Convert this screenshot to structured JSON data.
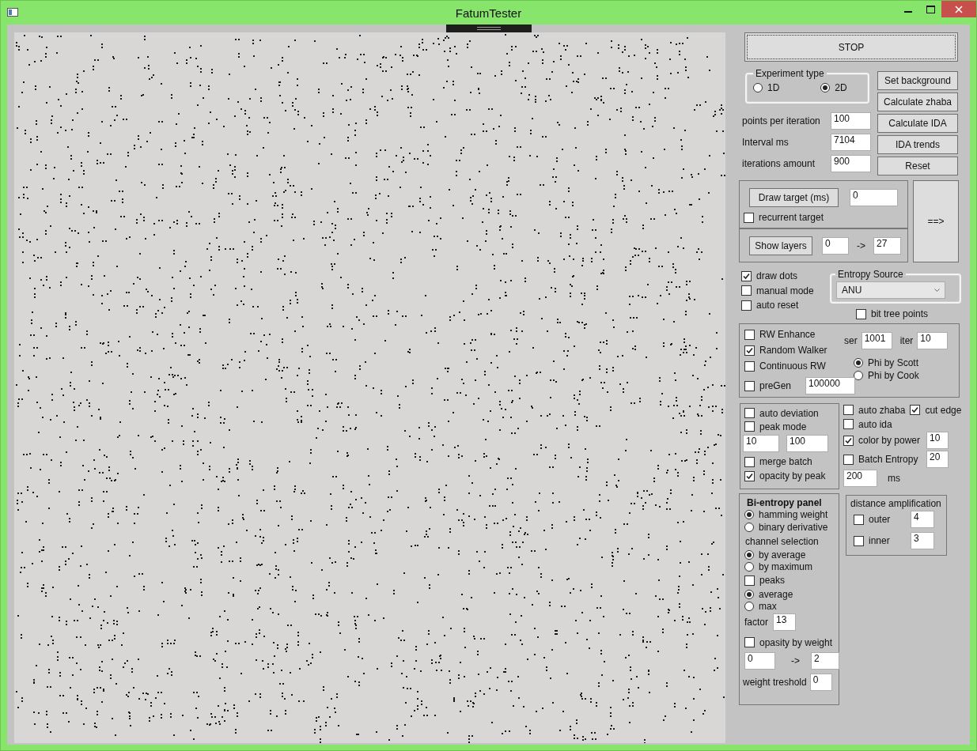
{
  "window": {
    "title": "FatumTester"
  },
  "stop_button": "STOP",
  "experiment_type": {
    "title": "Experiment type",
    "options": [
      {
        "label": "1D",
        "selected": false
      },
      {
        "label": "2D",
        "selected": true
      }
    ]
  },
  "action_buttons": [
    "Set background",
    "Calculate zhaba",
    "Calculate IDA",
    "IDA trends",
    "Reset"
  ],
  "params": [
    {
      "label": "points per iteration",
      "value": "100"
    },
    {
      "label": "Interval ms",
      "value": "7104"
    },
    {
      "label": "iterations amount",
      "value": "900"
    }
  ],
  "target": {
    "button": "Draw target (ms)",
    "value": "0",
    "recurrent": {
      "label": "recurrent target",
      "checked": false
    }
  },
  "layers": {
    "button": "Show layers",
    "from": "0",
    "arrow": "->",
    "to": "27"
  },
  "next_button": "==>",
  "options": [
    {
      "label": "draw dots",
      "checked": true
    },
    {
      "label": "manual mode",
      "checked": false
    },
    {
      "label": "auto reset",
      "checked": false
    }
  ],
  "entropy_source": {
    "title": "Entropy Source",
    "value": "ANU"
  },
  "bit_tree_points": {
    "label": "bit tree points",
    "checked": false
  },
  "rw_panel": {
    "checks": [
      {
        "label": "RW Enhance",
        "checked": false
      },
      {
        "label": "Random Walker",
        "checked": true
      },
      {
        "label": "Continuous  RW",
        "checked": false
      },
      {
        "label": "preGen",
        "checked": false
      }
    ],
    "pregen_value": "100000",
    "ser": {
      "label": "ser",
      "value": "1001"
    },
    "iter": {
      "label": "iter",
      "value": "10"
    },
    "phi": [
      {
        "label": "Phi by Scott",
        "selected": true
      },
      {
        "label": "Phi by Cook",
        "selected": false
      }
    ]
  },
  "deviation_panel": {
    "top_checks": [
      {
        "label": "auto deviation",
        "checked": false
      },
      {
        "label": "peak mode",
        "checked": false
      }
    ],
    "values": [
      "10",
      "100"
    ],
    "bottom_checks": [
      {
        "label": "merge batch",
        "checked": false
      },
      {
        "label": "opacity by peak",
        "checked": true
      }
    ]
  },
  "auto_panel": {
    "auto_zhaba": {
      "label": "auto zhaba",
      "checked": false
    },
    "cut_edge": {
      "label": "cut edge",
      "checked": true
    },
    "auto_ida": {
      "label": "auto ida",
      "checked": false
    },
    "color_by_power": {
      "label": "color by power",
      "checked": true,
      "value": "10"
    },
    "batch_entropy": {
      "label": "Batch Entropy",
      "checked": false,
      "value": "20"
    },
    "interval": {
      "value": "200",
      "unit": "ms"
    }
  },
  "bi_entropy": {
    "title": "Bi-entropy panel",
    "modes": [
      {
        "label": "hamming weight",
        "selected": true
      },
      {
        "label": "binary derivative",
        "selected": false
      }
    ],
    "channel_title": "channel selection",
    "channels": [
      {
        "label": "by average",
        "selected": true
      },
      {
        "label": "by maximum",
        "selected": false
      }
    ],
    "peaks": {
      "label": "peaks",
      "checked": false
    },
    "peak_modes": [
      {
        "label": "average",
        "selected": true
      },
      {
        "label": "max",
        "selected": false
      }
    ],
    "factor": {
      "label": "factor",
      "value": "13"
    },
    "opasity": {
      "label": "opasity by weight",
      "checked": false
    },
    "range": {
      "from": "0",
      "arrow": "->",
      "to": "2"
    },
    "threshold": {
      "label": "weight treshold",
      "value": "0"
    }
  },
  "distance_amplification": {
    "title": "distance amplification",
    "items": [
      {
        "label": "outer",
        "checked": false,
        "value": "4"
      },
      {
        "label": "inner",
        "checked": false,
        "value": "3"
      }
    ]
  }
}
